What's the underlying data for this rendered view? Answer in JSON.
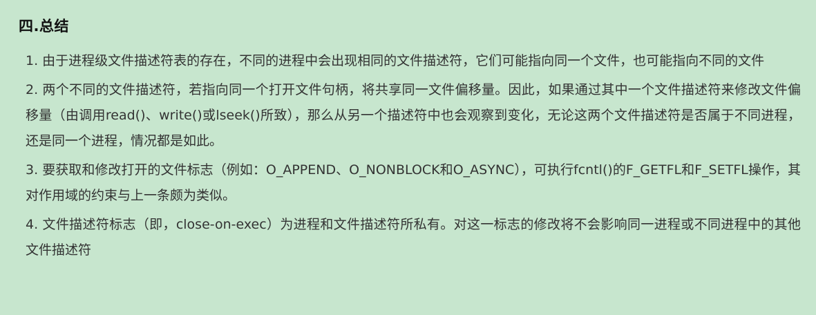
{
  "section": {
    "title": "四.总结"
  },
  "items": [
    "1. 由于进程级文件描述符表的存在，不同的进程中会出现相同的文件描述符，它们可能指向同一个文件，也可能指向不同的文件",
    "2. 两个不同的文件描述符，若指向同一个打开文件句柄，将共享同一文件偏移量。因此，如果通过其中一个文件描述符来修改文件偏移量（由调用read()、write()或lseek()所致），那么从另一个描述符中也会观察到变化，无论这两个文件描述符是否属于不同进程，还是同一个进程，情况都是如此。",
    "3. 要获取和修改打开的文件标志（例如：O_APPEND、O_NONBLOCK和O_ASYNC），可执行fcntl()的F_GETFL和F_SETFL操作，其对作用域的约束与上一条颇为类似。",
    "4. 文件描述符标志（即，close-on-exec）为进程和文件描述符所私有。对这一标志的修改将不会影响同一进程或不同进程中的其他文件描述符"
  ]
}
